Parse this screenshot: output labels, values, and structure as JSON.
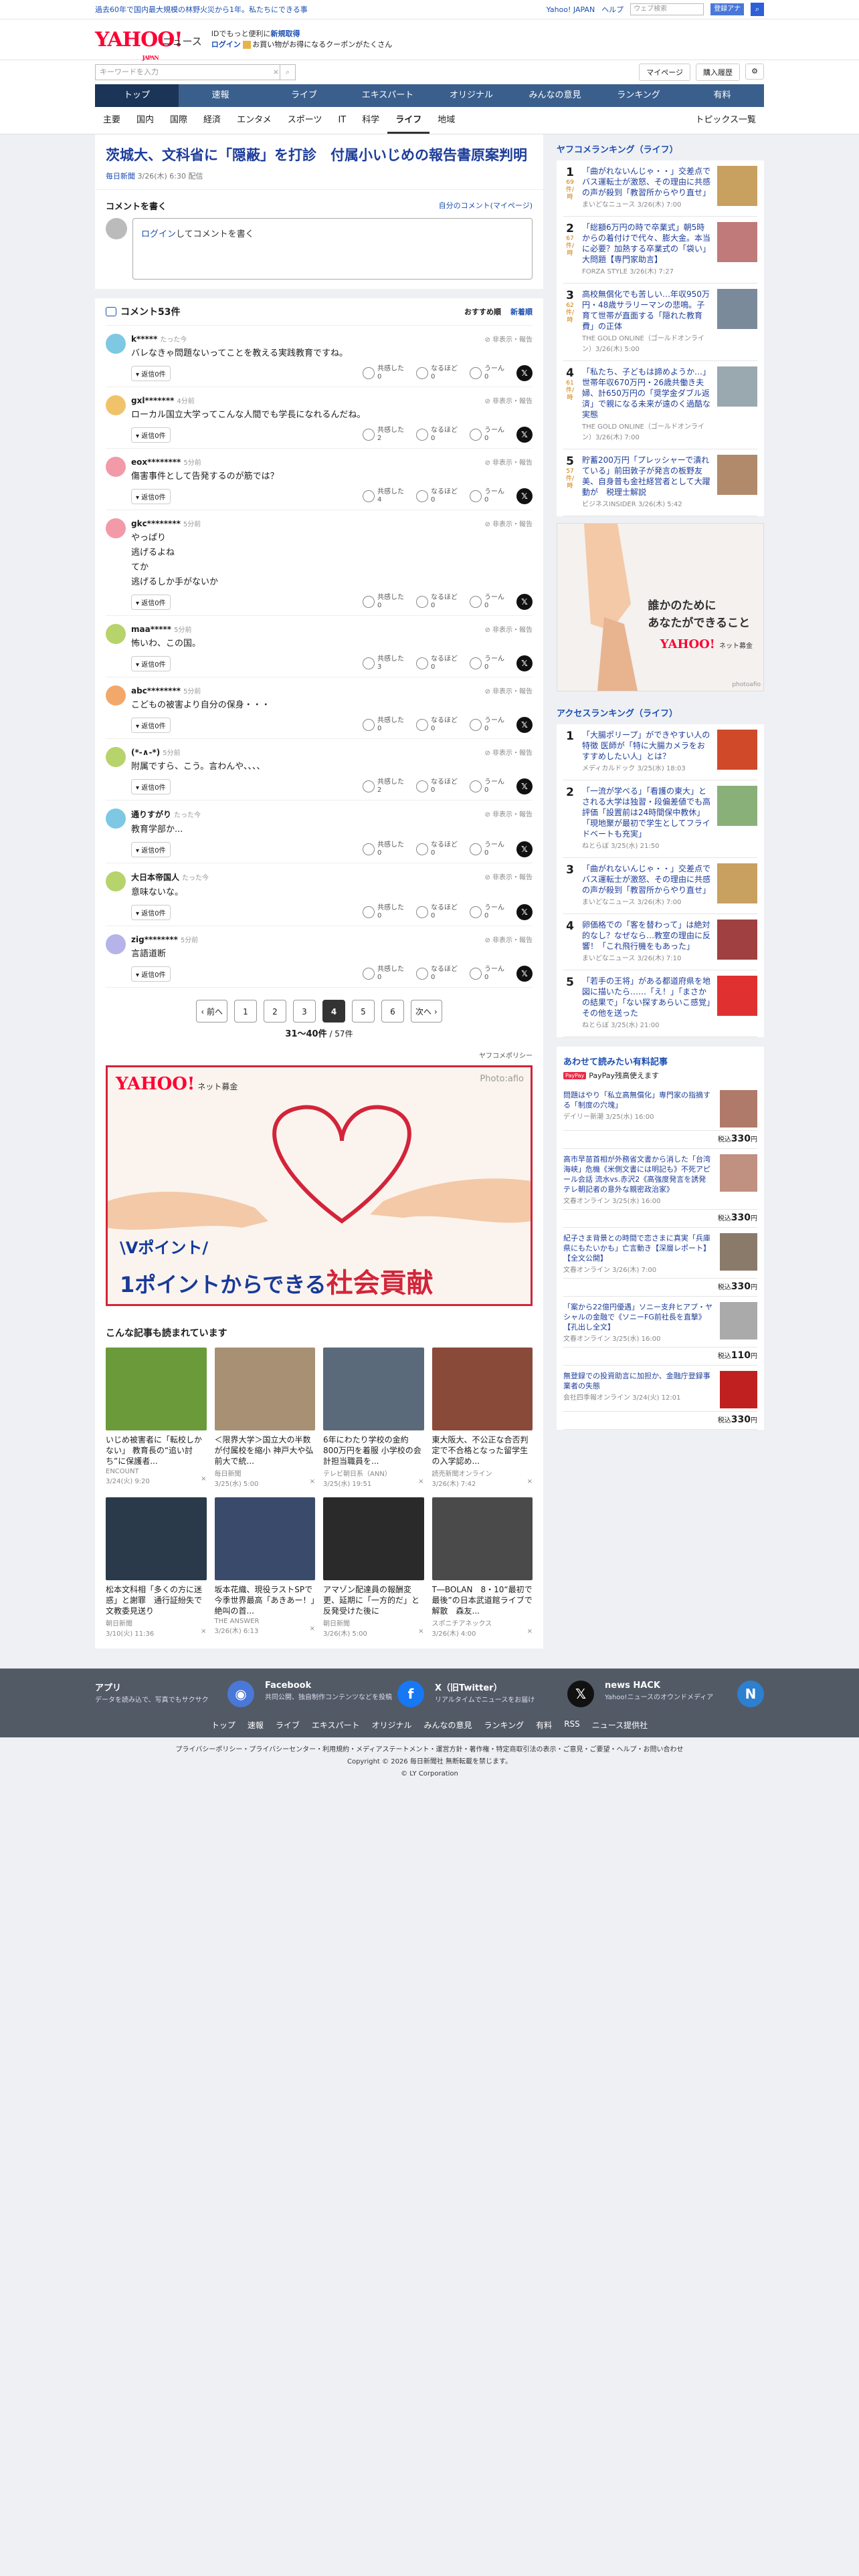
{
  "top": {
    "notice": "過去60年で国内最大規模の林野火災から1年。私たちにできる事",
    "links": [
      "Yahoo! JAPAN",
      "ヘルプ"
    ],
    "search_placeholder": "ウェブ検索",
    "search_btn": "登録アナ"
  },
  "header": {
    "logo": "YAHOO!",
    "logo_japan": "JAPAN",
    "logo_sub": "ニュース",
    "promo1a": "IDでもっと便利に",
    "promo1b": "新規取得",
    "promo2a": "ログイン",
    "promo2b": "お買い物がお得になるクーポンがたくさん"
  },
  "search": {
    "placeholder": "キーワードを入力",
    "mypage": "マイページ",
    "purchase": "購入履歴"
  },
  "tabs": [
    "トップ",
    "速報",
    "ライブ",
    "エキスパート",
    "オリジナル",
    "みんなの意見",
    "ランキング",
    "有料"
  ],
  "subtabs": [
    "主要",
    "国内",
    "国際",
    "経済",
    "エンタメ",
    "スポーツ",
    "IT",
    "科学",
    "ライフ",
    "地域"
  ],
  "subtab_right": "トピックス一覧",
  "article": {
    "title": "茨城大、文科省に「隠蔽」を打診　付属小いじめの報告書原案判明",
    "source": "毎日新聞",
    "date": "3/26(木) 6:30 配信"
  },
  "comment_write": {
    "heading": "コメントを書く",
    "my": "自分のコメント(マイページ)",
    "login": "ログイン",
    "prompt": "してコメントを書く"
  },
  "comments_header": {
    "title": "コメント53件",
    "sort1": "おすすめ順",
    "sort2": "新着順"
  },
  "labels": {
    "report": "非表示・報告",
    "reply": "返信0件",
    "r1": "共感した",
    "r2": "なるほど",
    "r3": "うーん",
    "x": "𝕏"
  },
  "comments": [
    {
      "user": "k*****",
      "time": "たった今",
      "text": "バレなきゃ問題ないってことを教える実践教育ですね。",
      "c1": "0",
      "c2": "0",
      "c3": "0",
      "color": "#7ec8e3"
    },
    {
      "user": "gxl*******",
      "time": "4分前",
      "text": "ローカル国立大学ってこんな人間でも学長になれるんだね。",
      "c1": "2",
      "c2": "0",
      "c3": "0",
      "color": "#f0c36b"
    },
    {
      "user": "eox********",
      "time": "5分前",
      "text": "傷害事件として告発するのが筋では？",
      "c1": "4",
      "c2": "0",
      "c3": "0",
      "color": "#f29aa8"
    },
    {
      "user": "gkc********",
      "time": "5分前",
      "text": "やっぱり\n逃げるよね\nてか\n逃げるしか手がないか",
      "c1": "0",
      "c2": "0",
      "c3": "0",
      "color": "#f29aa8"
    },
    {
      "user": "maa*****",
      "time": "5分前",
      "text": "怖いわ、この国。",
      "c1": "3",
      "c2": "0",
      "c3": "0",
      "color": "#b7d36b"
    },
    {
      "user": "abc********",
      "time": "5分前",
      "text": "こどもの被害より自分の保身・・・",
      "c1": "0",
      "c2": "0",
      "c3": "0",
      "color": "#f2a86b"
    },
    {
      "user": "(*-∧-*)",
      "time": "5分前",
      "text": "附属ですら、こう。言わんや、、、、",
      "c1": "2",
      "c2": "0",
      "c3": "0",
      "color": "#b7d36b"
    },
    {
      "user": "通りすがり",
      "time": "たった今",
      "text": "教育学部か...",
      "c1": "0",
      "c2": "0",
      "c3": "0",
      "color": "#7ec8e3"
    },
    {
      "user": "大日本帝国人",
      "time": "たった今",
      "text": "意味ないな。",
      "c1": "0",
      "c2": "0",
      "c3": "0",
      "color": "#b7d36b"
    },
    {
      "user": "zig********",
      "time": "5分前",
      "text": "言語道断",
      "c1": "0",
      "c2": "0",
      "c3": "0",
      "color": "#b5b3e8"
    }
  ],
  "pager": {
    "prev": "前へ",
    "next": "次へ",
    "pages": [
      "1",
      "2",
      "3",
      "4",
      "5",
      "6"
    ],
    "current": "4",
    "range": "31〜40件",
    "total": "/ 57件",
    "policy": "ヤフコメポリシー"
  },
  "ad_big": {
    "brand": "YAHOO!",
    "sub": "ネット募金",
    "photo": "Photo:afio",
    "vp": "\\Vポイント/",
    "line1": "1ポイントからできる",
    "line2": "社会貢献"
  },
  "related": {
    "heading": "こんな記事も読まれています",
    "items": [
      {
        "title": "いじめ被害者に「転校しかない」 教育長の“追い討ち”に保護者...",
        "src": "ENCOUNT",
        "date": "3/24(火) 9:20",
        "color": "#6a9a3a"
      },
      {
        "title": "＜限界大学＞国立大の半数が付属校を縮小 神戸大や弘前大で統...",
        "src": "毎日新聞",
        "date": "3/25(水) 5:00",
        "color": "#a89074"
      },
      {
        "title": "6年にわたり学校の金約800万円を着服 小学校の会計担当職員を...",
        "src": "テレビ朝日系（ANN）",
        "date": "3/25(水) 19:51",
        "color": "#5a6a7a"
      },
      {
        "title": "東大阪大、不公正な合否判定で不合格となった留学生の入学認め...",
        "src": "読売新聞オンライン",
        "date": "3/26(木) 7:42",
        "color": "#8a4a3a"
      },
      {
        "title": "松本文科相「多くの方に迷惑」と謝罪　通行証紛失で文教委見送り",
        "src": "朝日新聞",
        "date": "3/10(火) 11:36",
        "color": "#2a3a4a"
      },
      {
        "title": "坂本花織、現役ラストSPで今季世界最高「あきあー！」絶叫の首...",
        "src": "THE ANSWER",
        "date": "3/26(木) 6:13",
        "color": "#3a4a6a"
      },
      {
        "title": "アマゾン配達員の報酬変更、延期に「一方的だ」と反発受けた後に",
        "src": "朝日新聞",
        "date": "3/26(木) 5:00",
        "color": "#2a2a2a"
      },
      {
        "title": "T―BOLAN　8・10“最初で最後”の日本武道館ライブで解散　森友...",
        "src": "スポニチアネックス",
        "date": "3/26(木) 4:00",
        "color": "#4a4a4a"
      }
    ]
  },
  "ranking": {
    "heading": "ヤフコメランキング（ライフ）",
    "unit": "件/時",
    "items": [
      {
        "n": "1",
        "cnt": "69",
        "title": "「曲がれないんじゃ・・」交差点でバス運転士が激怒、その理由に共感の声が殺到「教習所からやり直せ」",
        "src": "まいどなニュース 3/26(木) 7:00",
        "color": "#c8a060"
      },
      {
        "n": "2",
        "cnt": "67",
        "title": "「総額6万円の時で卒業式」朝5時からの着付けで代々、膨大金。本当に必要？加熱する卒業式の「袋い」大問題【専門家助言】",
        "src": "FORZA STYLE 3/26(木) 7:27",
        "color": "#c07a7a"
      },
      {
        "n": "3",
        "cnt": "62",
        "title": "高校無償化でも苦しい…年収950万円・48歳サラリーマンの悲鳴。子育て世帯が直面する「隠れた教育費」の正体",
        "src": "THE GOLD ONLINE（ゴールドオンライン）3/26(木) 5:00",
        "color": "#7a8a9a"
      },
      {
        "n": "4",
        "cnt": "61",
        "title": "「私たち、子どもは諦めようか…」世帯年収670万円・26歳共働き夫婦、計650万円の「奨学金ダブル返済」で親になる未来が遠のく過酷な実態",
        "src": "THE GOLD ONLINE（ゴールドオンライン）3/26(木) 7:00",
        "color": "#9aa8b0"
      },
      {
        "n": "5",
        "cnt": "57",
        "title": "貯蓄200万円「プレッシャーで潰れている」前田敦子が発言の板野友美、自身普も金社経営者として大躍動が　税理士解説",
        "src": "ビジネスINSIDER 3/26(木) 5:42",
        "color": "#b08a6a"
      }
    ]
  },
  "side_ad": {
    "line1": "誰かのために",
    "line2": "あなたができること",
    "brand": "YAHOO!",
    "sub": "ネット募金",
    "photo": "photoafio"
  },
  "access": {
    "heading": "アクセスランキング（ライフ）",
    "items": [
      {
        "n": "1",
        "title": "「大腸ポリープ」ができやすい人の特徴 医師が「特に大腸カメラをおすすめしたい人」とは？",
        "src": "メディカルドック 3/25(水) 18:03",
        "color": "#d04a2a"
      },
      {
        "n": "2",
        "title": "「一流が学べる」「看護の東大」とされる大学は独習・段偏差値でも高評価「設置前は24時間保中教休」「現地聚が最初で学生としてフライドベートも充実」",
        "src": "ねとらぼ 3/25(水) 21:50",
        "color": "#8ab07a"
      },
      {
        "n": "3",
        "title": "「曲がれないんじゃ・・」交差点でバス運転士が激怒、その理由に共感の声が殺到「教習所からやり直せ」",
        "src": "まいどなニュース 3/26(木) 7:00",
        "color": "#c8a060"
      },
      {
        "n": "4",
        "title": "卵価格での「客を替わって」は絶対的なし？なぜなら…教室の理由に反響！「これ飛行機をもあった」",
        "src": "まいどなニュース 3/26(木) 7:10",
        "color": "#a04040"
      },
      {
        "n": "5",
        "title": "「若手の王将」がある都道府県を地図に描いたら……「え！」「まさかの結果で」「ない探すあらいこ感覚」その他を送った",
        "src": "ねとらぼ 3/25(水) 21:00",
        "color": "#e03030"
      }
    ]
  },
  "paid": {
    "heading": "あわせて読みたい有料記事",
    "paypay_badge": "PayPay",
    "paypay_text": "PayPay残高使えます",
    "price_prefix": "税込",
    "items": [
      {
        "title": "問題はやり「私立高無償化」専門家の指摘する「制度の穴塊」",
        "src": "デイリー新潮 3/25(水) 16:00",
        "price": "330",
        "color": "#b07a6a"
      },
      {
        "title": "高市早苗首相が外務省文書から消した「台湾海峡」危機《米側文書には明記も》不死アピール会話 流水vs.赤沢2《高強度発言を誘発 テレ朝記者の意外な親密政治家》",
        "src": "文春オンライン 3/25(水) 16:00",
        "price": "330",
        "color": "#c09080"
      },
      {
        "title": "紀子さま背景との時間で恋さまに真実「兵庫県にもたいかも」亡言動き【深層レポート】【全文公開】",
        "src": "文春オンライン 3/26(木) 7:00",
        "price": "330",
        "color": "#8a7a6a"
      },
      {
        "title": "「案から22億円優遇」ソニー支弁ヒアプ・ヤシャルの金融で《ソニーFG前社長を直撃》【孔出し全文】",
        "src": "文春オンライン 3/25(水) 16:00",
        "price": "110",
        "color": "#aaa"
      },
      {
        "title": "無登録での投資助言に加担か、金融庁登録事業者の失態",
        "src": "会社四季報オンライン 3/24(火) 12:01",
        "price": "330",
        "color": "#c02020"
      }
    ]
  },
  "footer": {
    "cells": [
      {
        "t": "アプリ",
        "d": "データを読み込で、写真でもサクサク",
        "color": "#4a78d8",
        "icon": "◉"
      },
      {
        "t": "Facebook",
        "d": "共同公開、独自制作コンテンツなどを投稿",
        "color": "#1877f2",
        "icon": "f"
      },
      {
        "t": "X（旧Twitter）",
        "d": "リアルタイムでニュースをお届け",
        "color": "#111",
        "icon": "𝕏"
      },
      {
        "t": "news HACK",
        "d": "Yahoo!ニュースのオウンドメディア",
        "color": "#2d7fcf",
        "icon": "N"
      }
    ],
    "links": [
      "トップ",
      "速報",
      "ライブ",
      "エキスパート",
      "オリジナル",
      "みんなの意見",
      "ランキング",
      "有料",
      "RSS",
      "ニュース提供社"
    ],
    "bottom1": "プライバシーポリシー・プライバシーセンター・利用規約・メディアステートメント・運営方針・著作権・特定商取引法の表示・ご意見・ご要望・ヘルプ・お問い合わせ",
    "bottom2": "Copyright © 2026 毎日新聞社 無断転載を禁じます。",
    "bottom3": "© LY Corporation"
  }
}
